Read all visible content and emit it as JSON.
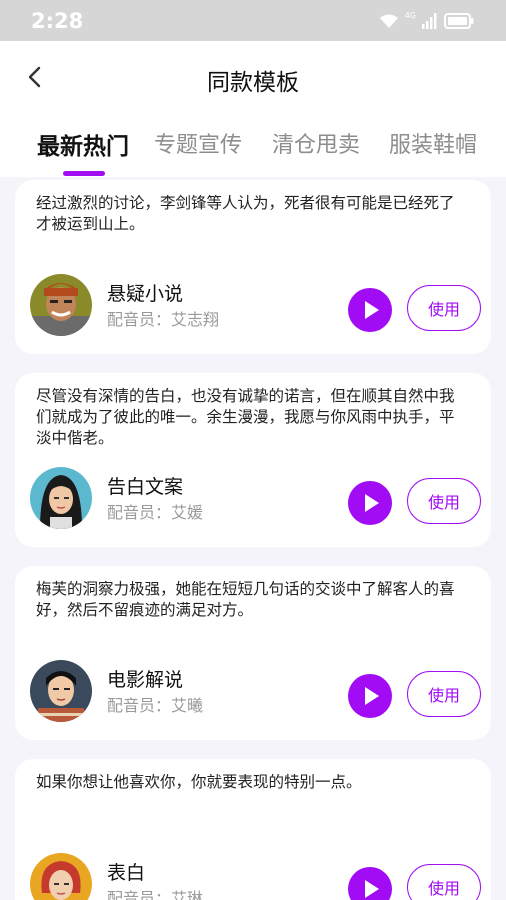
{
  "status_bar": {
    "time": "2:28",
    "network": "4G"
  },
  "header": {
    "title": "同款模板",
    "back_icon": "chevron-left-icon"
  },
  "tabs": [
    {
      "label": "最新热门",
      "active": true
    },
    {
      "label": "专题宣传",
      "active": false
    },
    {
      "label": "清仓甩卖",
      "active": false
    },
    {
      "label": "服装鞋帽",
      "active": false
    }
  ],
  "accent_color": "#a10cf5",
  "cards": [
    {
      "text": "经过激烈的讨论，李剑锋等人认为，死者很有可能是已经死了才被运到山上。",
      "voice_name": "悬疑小说",
      "actor": "配音员：艾志翔",
      "use_label": "使用"
    },
    {
      "text": "尽管没有深情的告白，也没有诚挚的诺言，但在顺其自然中我们就成为了彼此的唯一。余生漫漫，我愿与你风雨中执手，平淡中偕老。",
      "voice_name": "告白文案",
      "actor": "配音员：艾媛",
      "use_label": "使用"
    },
    {
      "text": "梅芙的洞察力极强，她能在短短几句话的交谈中了解客人的喜好，然后不留痕迹的满足对方。",
      "voice_name": "电影解说",
      "actor": "配音员：艾曦",
      "use_label": "使用"
    },
    {
      "text": "如果你想让他喜欢你，你就要表现的特别一点。",
      "voice_name": "表白",
      "actor": "配音员：艾琳",
      "use_label": "使用"
    }
  ]
}
